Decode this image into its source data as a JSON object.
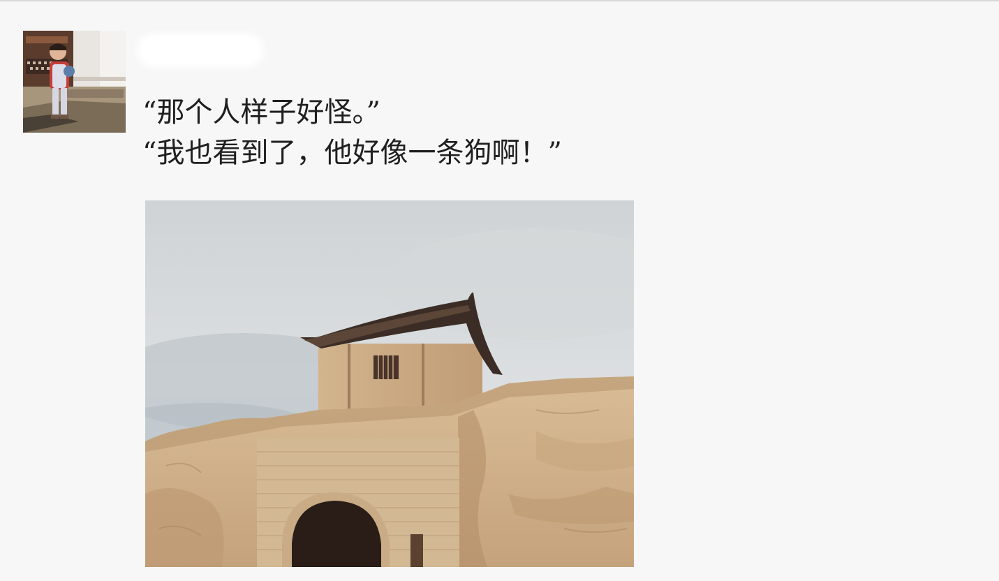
{
  "post": {
    "author_name": "",
    "lines": [
      "“那个人样子好怪。”",
      "“我也看到了，他好像一条狗啊！”"
    ]
  },
  "icons": {
    "avatar": "user-avatar-photo",
    "photo": "post-photo"
  },
  "colors": {
    "background": "#f7f7f7",
    "author_name": "#5a6d94",
    "text": "#1f1f1f"
  }
}
